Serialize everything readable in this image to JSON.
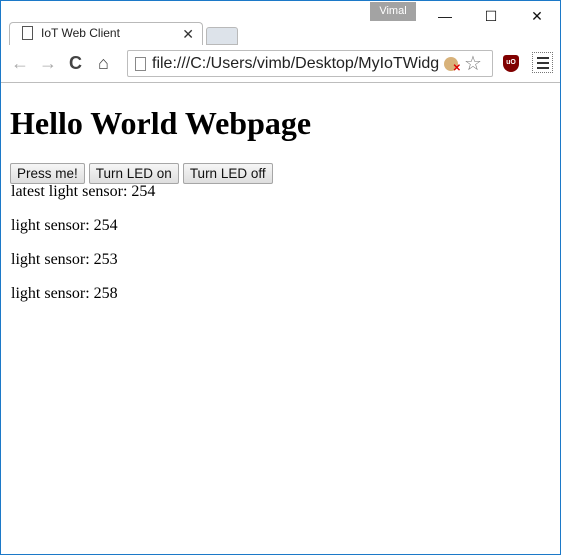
{
  "window": {
    "profile_name": "Vimal",
    "controls": {
      "minimize": "—",
      "maximize": "☐",
      "close": "✕"
    }
  },
  "tab": {
    "title": "IoT Web Client",
    "close": "✕"
  },
  "toolbar": {
    "back": "←",
    "forward": "→",
    "reload": "C",
    "home": "⌂",
    "url": "file:///C:/Users/vimb/Desktop/MyIoTWidg",
    "star": "☆",
    "ublock_label": "uO"
  },
  "page": {
    "heading": "Hello World Webpage",
    "buttons": [
      "Press me!",
      "Turn LED on",
      "Turn LED off"
    ],
    "latest": "latest light sensor: 254",
    "readings": [
      "light sensor: 254",
      "light sensor: 253",
      "light sensor: 258"
    ]
  }
}
